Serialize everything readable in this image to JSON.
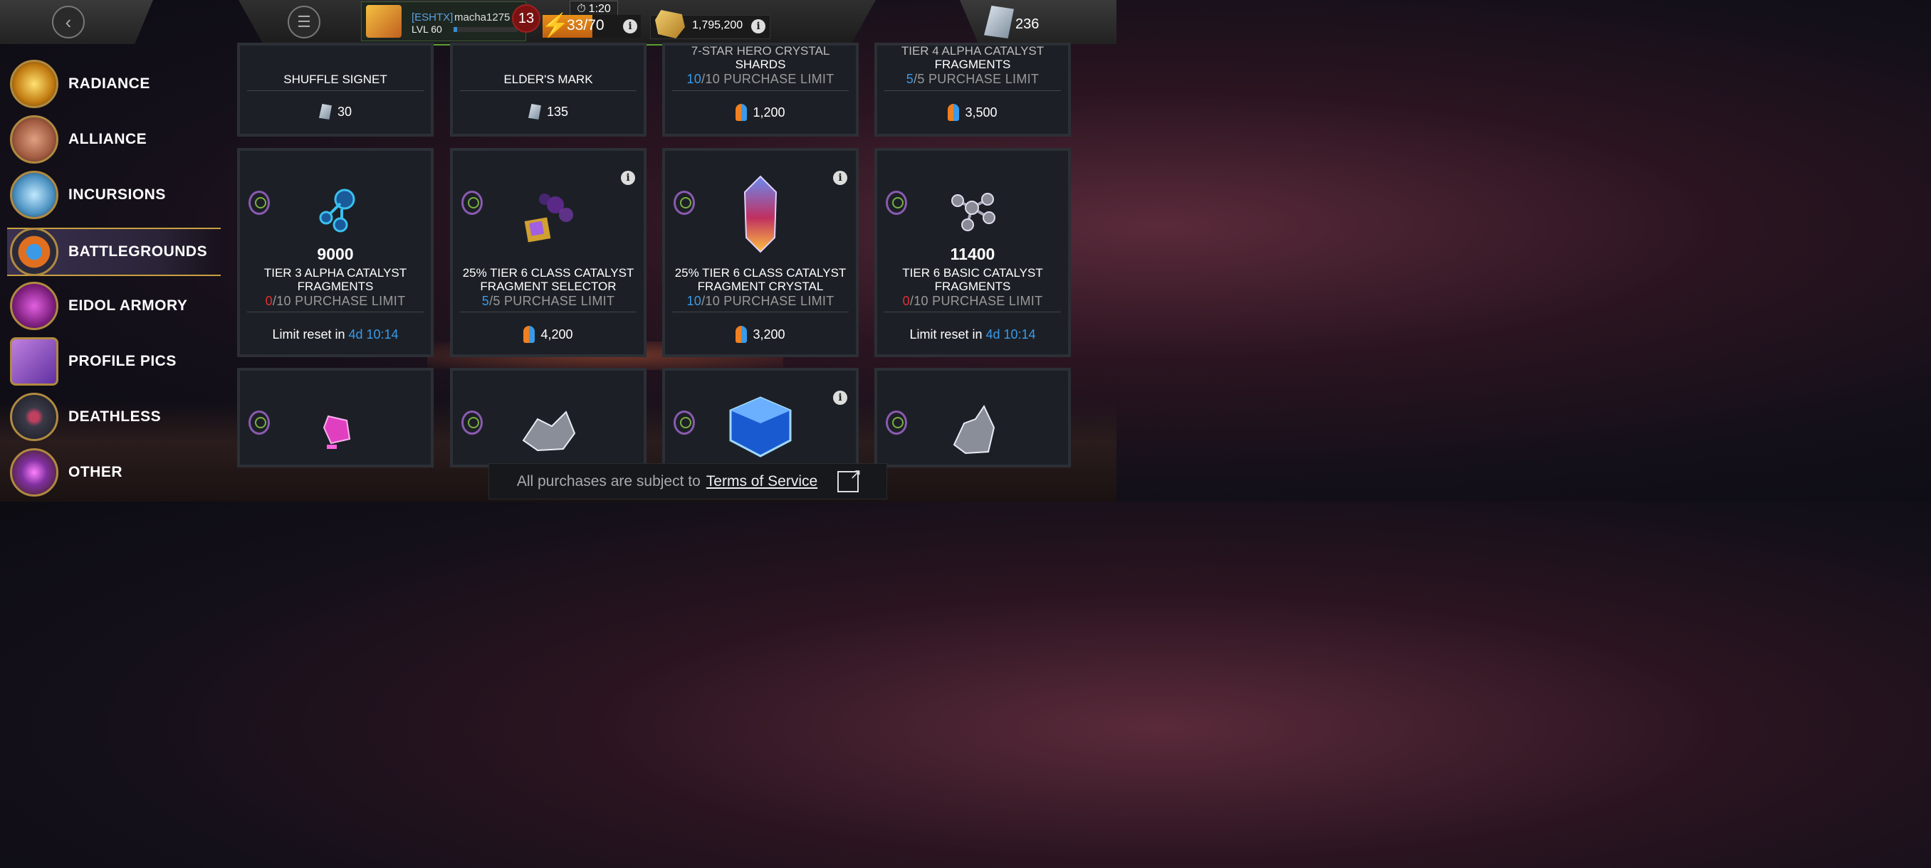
{
  "topbar": {
    "player_tag": "[ESHTX]",
    "player_name": "macha1275",
    "level": "LVL 60",
    "notifications": "13",
    "timer": "1:20",
    "energy_current": "33",
    "energy_max": "/70",
    "gold": "1,795,200",
    "units": "236"
  },
  "sidebar": {
    "items": [
      {
        "label": "RADIANCE"
      },
      {
        "label": "ALLIANCE"
      },
      {
        "label": "INCURSIONS"
      },
      {
        "label": "BATTLEGROUNDS"
      },
      {
        "label": "EIDOL ARMORY"
      },
      {
        "label": "PROFILE PICS"
      },
      {
        "label": "DEATHLESS"
      },
      {
        "label": "OTHER"
      }
    ],
    "active": "BATTLEGROUNDS"
  },
  "row1": [
    {
      "name": "SHUFFLE SIGNET",
      "price": "30"
    },
    {
      "name": "ELDER'S MARK",
      "price": "135"
    },
    {
      "name_top": "7-STAR HERO CRYSTAL",
      "name": "SHARDS",
      "limit_cur": "10",
      "limit_rest": "/10 PURCHASE LIMIT",
      "price": "1,200"
    },
    {
      "name_top": "TIER 4 ALPHA CATALYST",
      "name": "FRAGMENTS",
      "limit_cur": "5",
      "limit_rest": "/5 PURCHASE LIMIT",
      "price": "3,500"
    }
  ],
  "row2": [
    {
      "qty": "9000",
      "name1": "TIER 3 ALPHA CATALYST",
      "name2": "FRAGMENTS",
      "limit_cur": "0",
      "limit_rest": "/10 PURCHASE LIMIT",
      "reset_label": "Limit reset in ",
      "reset_time": "4d 10:14"
    },
    {
      "name1": "25% TIER 6 CLASS CATALYST",
      "name2": "FRAGMENT SELECTOR",
      "limit_cur": "5",
      "limit_rest": "/5 PURCHASE LIMIT",
      "price": "4,200"
    },
    {
      "name1": "25% TIER 6 CLASS CATALYST",
      "name2": "FRAGMENT CRYSTAL",
      "limit_cur": "10",
      "limit_rest": "/10 PURCHASE LIMIT",
      "price": "3,200"
    },
    {
      "qty": "11400",
      "name1": "TIER 6 BASIC CATALYST",
      "name2": "FRAGMENTS",
      "limit_cur": "0",
      "limit_rest": "/10 PURCHASE LIMIT",
      "reset_label": "Limit reset in ",
      "reset_time": "4d 10:14"
    }
  ],
  "footer": {
    "text": "All purchases are subject to",
    "link": "Terms of Service"
  }
}
